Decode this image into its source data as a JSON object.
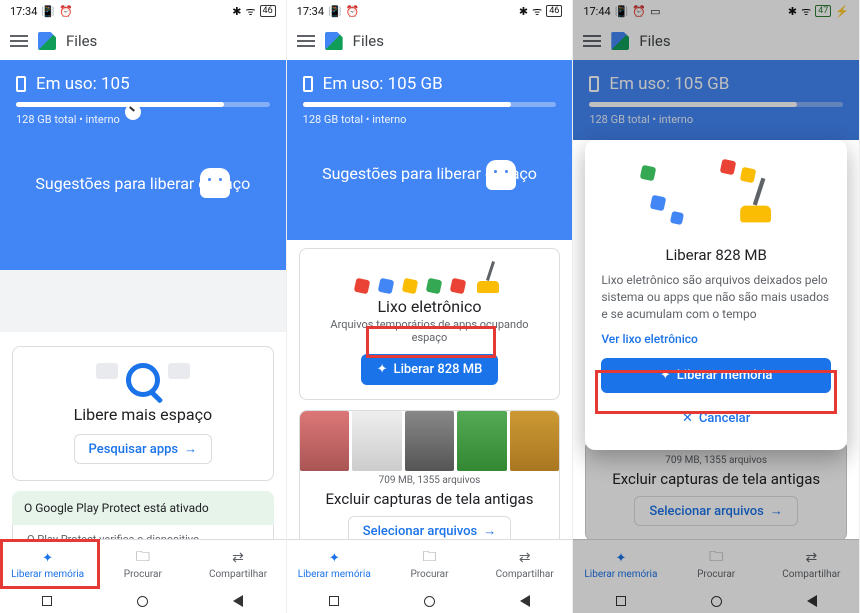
{
  "status": {
    "time1": "17:34",
    "time3": "17:44",
    "alarm_icon": "⏰",
    "bt_icon": "✱",
    "signal_icon": "📶",
    "batt1": "46",
    "batt3": "47"
  },
  "app": {
    "title": "Files"
  },
  "hero": {
    "usage_label": "Em uso: 105 GB",
    "usage_label_short": "Em uso: 105",
    "sub": "128 GB total • interno",
    "suggestion_title": "Sugestões para liberar espaço"
  },
  "card_search": {
    "title": "Libere mais espaço",
    "button": "Pesquisar apps"
  },
  "protect": {
    "banner": "O Google Play Protect está ativado",
    "sub": "O Play Protect verifica o dispositivo"
  },
  "junk_card": {
    "title": "Lixo eletrônico",
    "sub": "Arquivos temporários de apps ocupando espaço",
    "button": "Liberar 828 MB"
  },
  "screenshots_card": {
    "caption": "709 MB, 1355 arquivos",
    "title": "Excluir capturas de tela antigas",
    "button": "Selecionar arquivos"
  },
  "modal": {
    "title": "Liberar 828 MB",
    "desc": "Lixo eletrônico são arquivos deixados pelo sistema ou apps que não são mais usados e se acumulam com o tempo",
    "link": "Ver lixo eletrônico",
    "confirm": "Liberar memória",
    "cancel": "Cancelar"
  },
  "nav": {
    "clean": "Liberar memória",
    "browse": "Procurar",
    "share": "Compartilhar"
  },
  "icons": {
    "arrow": "→",
    "sparkle": "✦",
    "x": "✕"
  }
}
